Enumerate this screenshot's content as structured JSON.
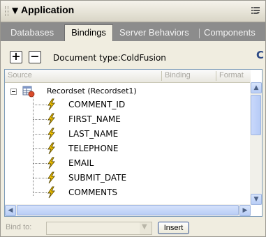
{
  "panel": {
    "title": "Application",
    "collapse_glyph": "▼"
  },
  "tabs": [
    {
      "label": "Databases",
      "active": false
    },
    {
      "label": "Bindings",
      "active": true
    },
    {
      "label": "Server Behaviors",
      "active": false
    },
    {
      "label": "Components",
      "active": false
    }
  ],
  "toolbar": {
    "add_glyph": "+",
    "remove_glyph": "−",
    "document_type": "Document type:ColdFusion",
    "server_glyph": "C"
  },
  "columns": {
    "source": "Source",
    "binding": "Binding",
    "format": "Format"
  },
  "recordset": {
    "label": "Recordset (Recordset1)",
    "fields": [
      "COMMENT_ID",
      "FIRST_NAME",
      "LAST_NAME",
      "TELEPHONE",
      "EMAIL",
      "SUBMIT_DATE",
      "COMMENTS"
    ]
  },
  "scroll": {
    "up": "▲",
    "down": "▼",
    "left": "◀",
    "right": "▶"
  },
  "bottom_bar": {
    "bind_to_label": "Bind to:",
    "bind_to_value": "",
    "insert_label": "Insert"
  },
  "colors": {
    "tab_bar": "#8c8c8c",
    "panel_bg": "#f0ede0",
    "accent_blue": "#2e4f8f",
    "bolt_yellow": "#f2c200"
  }
}
